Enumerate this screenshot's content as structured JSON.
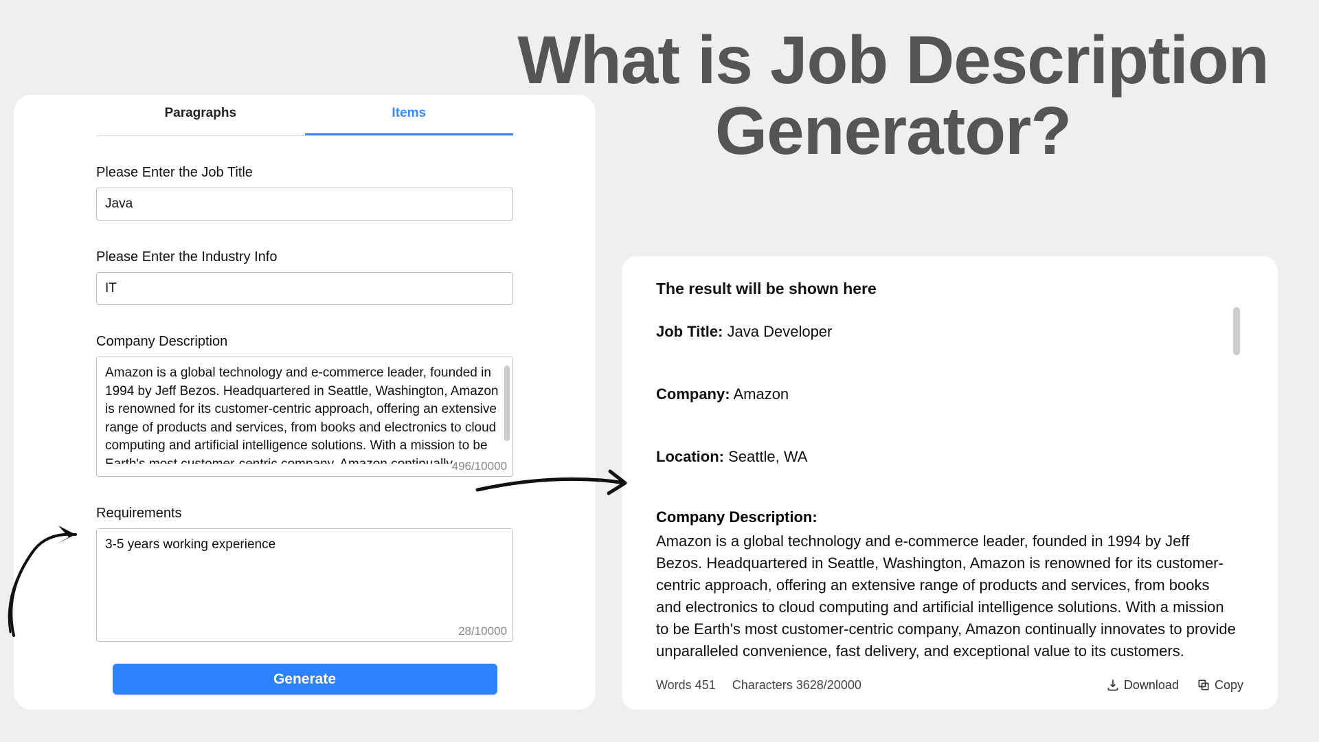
{
  "headline": "What is Job Description Generator?",
  "form": {
    "tabs": {
      "paragraphs": "Paragraphs",
      "items": "Items"
    },
    "job_title_label": "Please Enter the Job Title",
    "job_title_value": "Java",
    "industry_label": "Please Enter the Industry Info",
    "industry_value": "IT",
    "company_desc_label": "Company Description",
    "company_desc_value": "Amazon is a global technology and e-commerce leader, founded in 1994 by Jeff Bezos. Headquartered in Seattle, Washington, Amazon is renowned for its customer-centric approach, offering an extensive range of products and services, from books and electronics to cloud computing and artificial intelligence solutions. With a mission to be Earth's most customer-centric company, Amazon continually innovates",
    "company_char_count": "496/10000",
    "requirements_label": "Requirements",
    "requirements_value": "3-5 years working experience",
    "requirements_char_count": "28/10000",
    "generate_label": "Generate"
  },
  "result": {
    "heading": "The result will be shown here",
    "job_title_label": "Job Title:",
    "job_title_value": " Java Developer",
    "company_label": "Company:",
    "company_value": " Amazon",
    "location_label": "Location:",
    "location_value": " Seattle, WA",
    "desc_label": "Company Description:",
    "desc_value": "Amazon is a global technology and e-commerce leader, founded in 1994 by Jeff Bezos. Headquartered in Seattle, Washington, Amazon is renowned for its customer-centric approach, offering an extensive range of products and services, from books and electronics to cloud computing and artificial intelligence solutions. With a mission to be Earth's most customer-centric company, Amazon continually innovates to provide unparalleled convenience, fast delivery, and exceptional value to its customers.",
    "words_stat": "Words 451",
    "chars_stat": "Characters 3628/20000",
    "download_label": "Download",
    "copy_label": "Copy"
  }
}
